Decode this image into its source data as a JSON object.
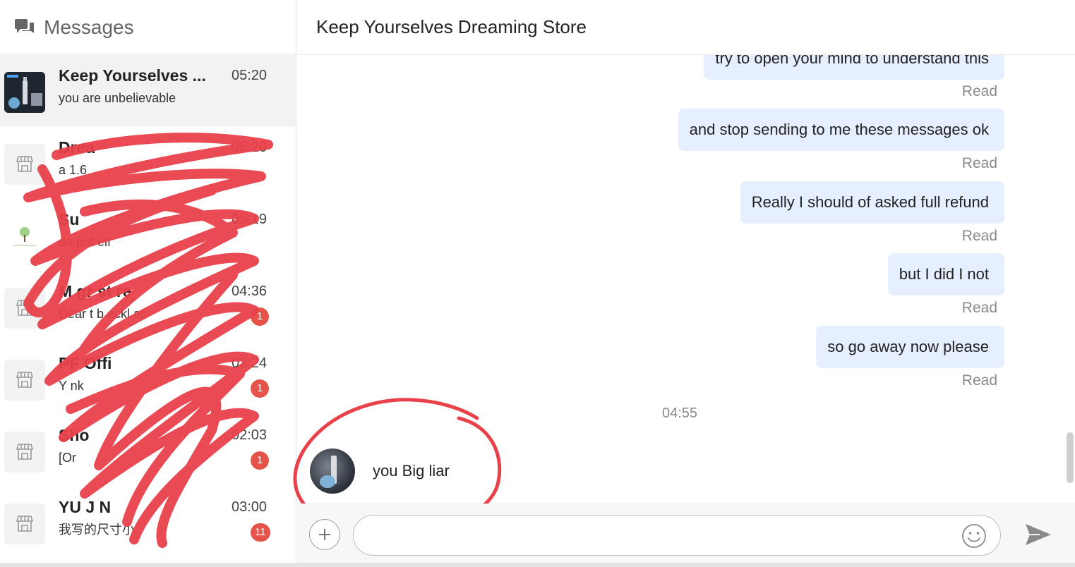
{
  "sidebar": {
    "title": "Messages",
    "conversations": [
      {
        "name": "Keep Yourselves ...",
        "time": "05:20",
        "preview": "you are unbelievable",
        "badge": "",
        "active": true
      },
      {
        "name": "Drea",
        "time": "05:20",
        "preview": "a  1.6",
        "badge": ""
      },
      {
        "name": "Su",
        "time": "05:19",
        "preview": "do  put  elf",
        "badge": ""
      },
      {
        "name": "M  gr  st  re",
        "time": "04:36",
        "preview": "Dear  t b  eckl  ac",
        "badge": "1"
      },
      {
        "name": "PF  Offi",
        "time": "03:24",
        "preview": "Y  nk",
        "badge": "1"
      },
      {
        "name": "Sho",
        "time": "02:03",
        "preview": "[Or",
        "badge": "1"
      },
      {
        "name": "YU J  N",
        "time": "03:00",
        "preview": "我写的尺寸小",
        "badge": "11"
      }
    ]
  },
  "chat": {
    "title": "Keep Yourselves Dreaming Store",
    "outgoing": [
      {
        "text": "try to open your mind to understand this",
        "status": "Read"
      },
      {
        "text": "and stop sending to me these messages ok",
        "status": "Read"
      },
      {
        "text": "Really I should of asked full refund",
        "status": "Read"
      },
      {
        "text": "but I did I not",
        "status": "Read"
      },
      {
        "text": "so go away now please",
        "status": "Read"
      }
    ],
    "timestamp": "04:55",
    "incoming": {
      "text": "you Big liar"
    }
  },
  "input": {
    "placeholder": "",
    "value": ""
  },
  "icons": {
    "header": "chat-bubbles-icon",
    "store": "storefront-icon",
    "attach": "plus-icon",
    "emoji": "smiley-icon",
    "send": "send-arrow-icon"
  },
  "colors": {
    "outgoing_bubble": "#e6efff",
    "badge": "#e5534b",
    "scribble": "#e8414a"
  }
}
